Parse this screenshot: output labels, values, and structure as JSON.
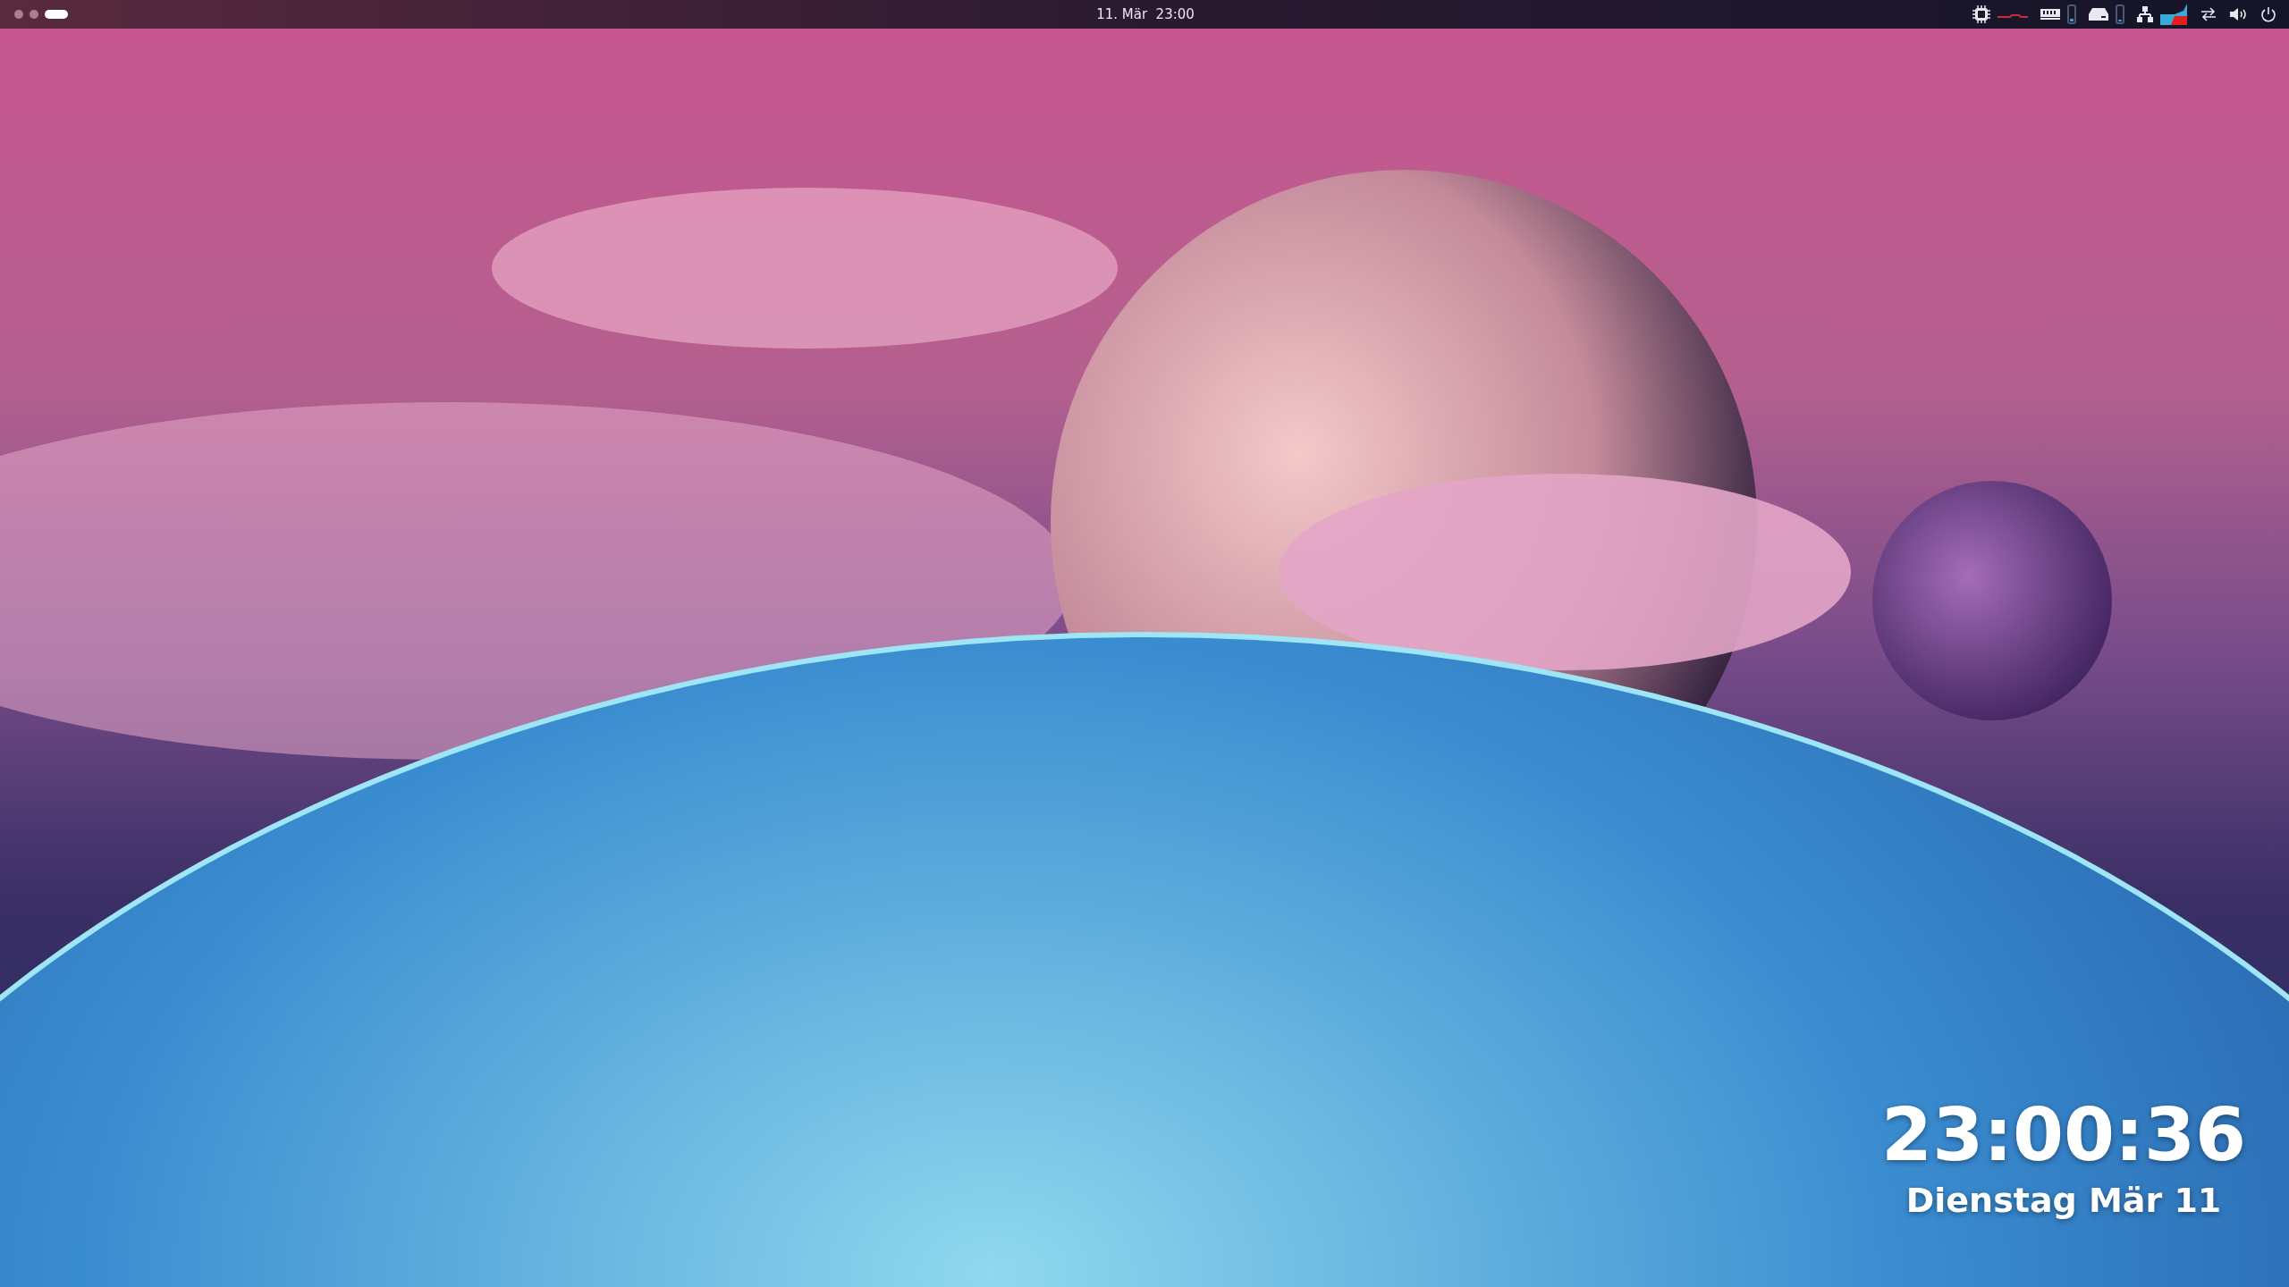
{
  "top_bar": {
    "workspaces": [
      {
        "selected": false
      },
      {
        "selected": false
      },
      {
        "selected": true
      }
    ],
    "clock": "11. Mär  23:00",
    "indicators": [
      {
        "kind": "cpu-graph"
      },
      {
        "kind": "memory-meter",
        "level": 0.3
      },
      {
        "kind": "disk-meter",
        "level": 0.2
      },
      {
        "kind": "network-graph"
      },
      {
        "kind": "network-arrows"
      },
      {
        "kind": "volume"
      },
      {
        "kind": "power"
      }
    ]
  },
  "desktop_clock": {
    "time": "23:00:36",
    "date": "Dienstag Mär 11"
  }
}
